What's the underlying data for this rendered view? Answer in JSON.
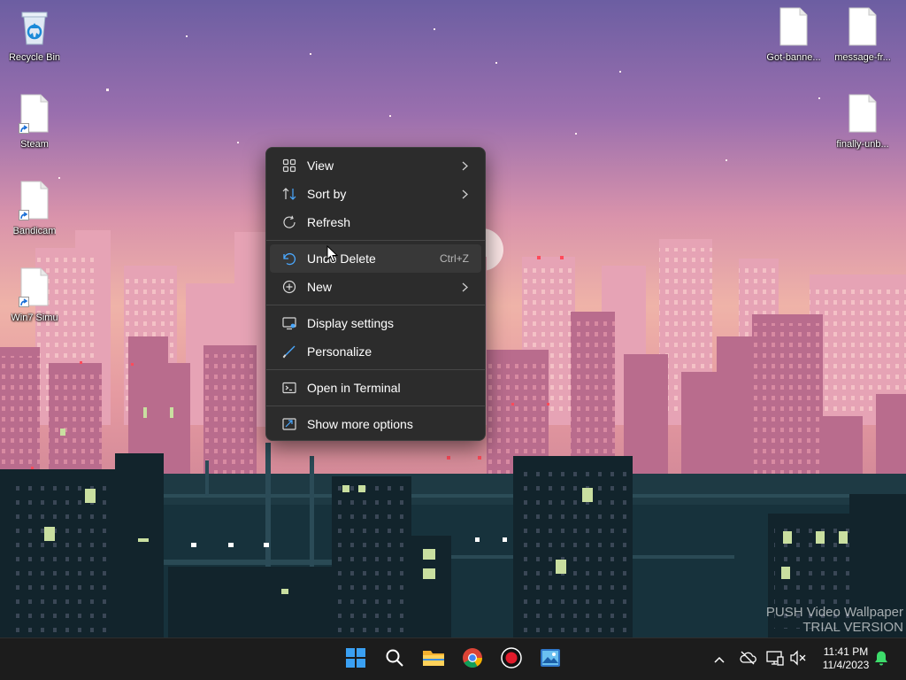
{
  "desktop": {
    "icons_left": [
      {
        "label": "Recycle Bin",
        "icon": "recycle-bin-icon"
      },
      {
        "label": "Steam",
        "icon": "file-shortcut-icon"
      },
      {
        "label": "Bandicam",
        "icon": "file-shortcut-icon"
      },
      {
        "label": "Win7 Simu",
        "icon": "file-shortcut-icon"
      }
    ],
    "icons_right": [
      {
        "label": "Got-banne...",
        "icon": "file-icon"
      },
      {
        "label": "message-fr...",
        "icon": "file-icon"
      },
      {
        "label": "finally-unb...",
        "icon": "file-icon"
      }
    ]
  },
  "context_menu": {
    "items": [
      {
        "label": "View",
        "icon": "grid-icon",
        "has_submenu": true
      },
      {
        "label": "Sort by",
        "icon": "sort-icon",
        "has_submenu": true
      },
      {
        "label": "Refresh",
        "icon": "refresh-icon"
      },
      {
        "label": "Undo Delete",
        "icon": "undo-icon",
        "shortcut": "Ctrl+Z",
        "highlighted": true
      },
      {
        "label": "New",
        "icon": "plus-circle-icon",
        "has_submenu": true
      },
      {
        "label": "Display settings",
        "icon": "display-icon"
      },
      {
        "label": "Personalize",
        "icon": "brush-icon"
      },
      {
        "label": "Open in Terminal",
        "icon": "terminal-icon"
      },
      {
        "label": "Show more options",
        "icon": "more-options-icon"
      }
    ]
  },
  "watermark": {
    "line1": "PUSH Video Wallpaper",
    "line2": "TRIAL VERSION"
  },
  "taskbar": {
    "apps": [
      "start-icon",
      "search-icon",
      "file-explorer-icon",
      "chrome-icon",
      "record-icon",
      "photos-icon"
    ],
    "tray": [
      "chevron-up-icon",
      "cloud-offline-icon",
      "network-icon",
      "volume-muted-icon",
      "notification-bell-icon"
    ],
    "clock": {
      "time": "11:41 PM",
      "date": "11/4/2023"
    }
  },
  "colors": {
    "menu_bg": "#2c2c2c",
    "menu_hover": "#383838",
    "accent": "#0a84ff",
    "taskbar_bg": "#1c1c1c"
  }
}
